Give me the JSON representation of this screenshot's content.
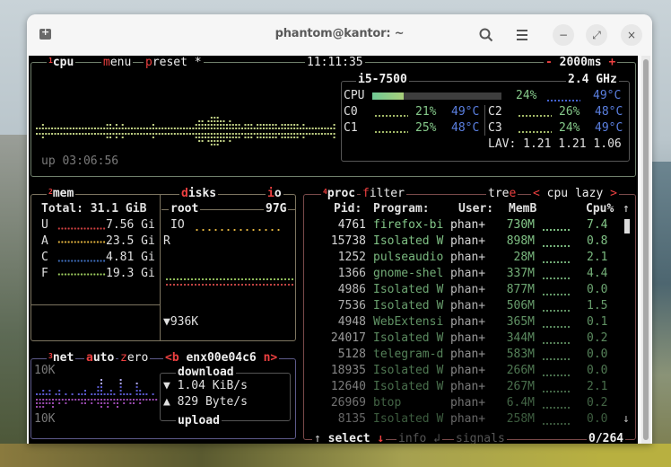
{
  "window": {
    "title": "phantom@kantor: ~",
    "buttons": {
      "new_tab": "new-tab-icon",
      "search": "search-icon",
      "menu": "hamburger-icon",
      "minimize": "−",
      "maximize": "⤢",
      "close": "×"
    }
  },
  "cpu_box": {
    "number": "1",
    "title": "cpu",
    "menu_hotkey": "m",
    "menu_rest": "enu",
    "preset_hotkey": "p",
    "preset_rest": "reset *",
    "clock": "11:11:35",
    "interval_minus": "-",
    "interval": "2000ms",
    "interval_plus": "+",
    "uptime": "up 03:06:56",
    "model": "i5-7500",
    "freq": "2.4 GHz",
    "total": {
      "label": "CPU",
      "percent_text": "24%",
      "percent": 24,
      "temp": "49°C"
    },
    "cores": [
      {
        "label": "C0",
        "percent": "21%",
        "temp": "49°C"
      },
      {
        "label": "C1",
        "percent": "25%",
        "temp": "48°C"
      },
      {
        "label": "C2",
        "percent": "26%",
        "temp": "48°C"
      },
      {
        "label": "C3",
        "percent": "24%",
        "temp": "49°C"
      }
    ],
    "lav_label": "LAV:",
    "lav": [
      "1.21",
      "1.21",
      "1.06"
    ]
  },
  "mem_box": {
    "number": "2",
    "title": "mem",
    "total": "Total: 31.1 GiB",
    "rows": [
      {
        "label": "U",
        "value": "7.56 Gi",
        "color": "#d04040"
      },
      {
        "label": "A",
        "value": "23.5 Gi",
        "color": "#e8b840"
      },
      {
        "label": "C",
        "value": "4.81 Gi",
        "color": "#4070c0"
      },
      {
        "label": "F",
        "value": "19.3 Gi",
        "color": "#a0d060"
      }
    ]
  },
  "disks_box": {
    "hotkey": "d",
    "title_rest": "isks",
    "io_hotkey": "i",
    "io_rest": "o",
    "disk_name": "root",
    "disk_size": "97G",
    "io_label": "IO",
    "r_label": "R",
    "read_speed": "▼936K"
  },
  "net_box": {
    "number": "3",
    "title": "net",
    "auto_hotkey": "a",
    "auto_rest": "uto",
    "zero_hotkey": "z",
    "zero_rest": "ero",
    "iface_prev": "<b",
    "iface": "enx00e04c6",
    "iface_next": "n>",
    "scale_top": "10K",
    "scale_bottom": "10K",
    "download_label": "download",
    "download_arrow": "▼",
    "download": "1.04 KiB/s",
    "upload_arrow": "▲",
    "upload": "829 Byte/s",
    "upload_label": "upload"
  },
  "proc_box": {
    "number": "4",
    "title": "proc",
    "filter_hotkey": "f",
    "filter_rest": "ilter",
    "tree_pre": "tre",
    "tree_hotkey": "e",
    "sort_prev": "<",
    "sort": "cpu lazy",
    "sort_next": ">",
    "columns": {
      "pid": "Pid:",
      "program": "Program:",
      "user": "User:",
      "mem": "MemB",
      "cpu": "Cpu%"
    },
    "scroll_up": "↑",
    "scroll_down": "↓",
    "rows": [
      {
        "pid": "4761",
        "program": "firefox-bi",
        "user": "phan+",
        "mem": "730M",
        "cpu": "7.4"
      },
      {
        "pid": "15738",
        "program": "Isolated W",
        "user": "phan+",
        "mem": "898M",
        "cpu": "0.8"
      },
      {
        "pid": "1252",
        "program": "pulseaudio",
        "user": "phan+",
        "mem": "28M",
        "cpu": "2.1"
      },
      {
        "pid": "1366",
        "program": "gnome-shel",
        "user": "phan+",
        "mem": "337M",
        "cpu": "4.4"
      },
      {
        "pid": "4986",
        "program": "Isolated W",
        "user": "phan+",
        "mem": "877M",
        "cpu": "0.0"
      },
      {
        "pid": "7536",
        "program": "Isolated W",
        "user": "phan+",
        "mem": "506M",
        "cpu": "1.5"
      },
      {
        "pid": "4948",
        "program": "WebExtensi",
        "user": "phan+",
        "mem": "365M",
        "cpu": "0.1"
      },
      {
        "pid": "24017",
        "program": "Isolated W",
        "user": "phan+",
        "mem": "344M",
        "cpu": "0.2"
      },
      {
        "pid": "5128",
        "program": "telegram-d",
        "user": "phan+",
        "mem": "583M",
        "cpu": "0.0"
      },
      {
        "pid": "18935",
        "program": "Isolated W",
        "user": "phan+",
        "mem": "266M",
        "cpu": "0.0"
      },
      {
        "pid": "12640",
        "program": "Isolated W",
        "user": "phan+",
        "mem": "267M",
        "cpu": "2.1"
      },
      {
        "pid": "26969",
        "program": "btop",
        "user": "phan+",
        "mem": "6.4M",
        "cpu": "0.2"
      },
      {
        "pid": "8135",
        "program": "Isolated W",
        "user": "phan+",
        "mem": "258M",
        "cpu": "0.0"
      }
    ],
    "footer": {
      "up_arrow": "↑",
      "select": "select",
      "down_arrow": "↓",
      "info": "info",
      "enter": "↲",
      "signals": "signals",
      "count": "0/264"
    }
  },
  "colors": {
    "cpu_border": "#6f7f6b",
    "mem_border": "#7d7560",
    "net_border": "#5d5a8a",
    "proc_border": "#7a4a4a",
    "hotkey": "#ee4040",
    "graph": "#c4d487",
    "temp": "#5a7fe0",
    "green_text": "#85c98a"
  }
}
